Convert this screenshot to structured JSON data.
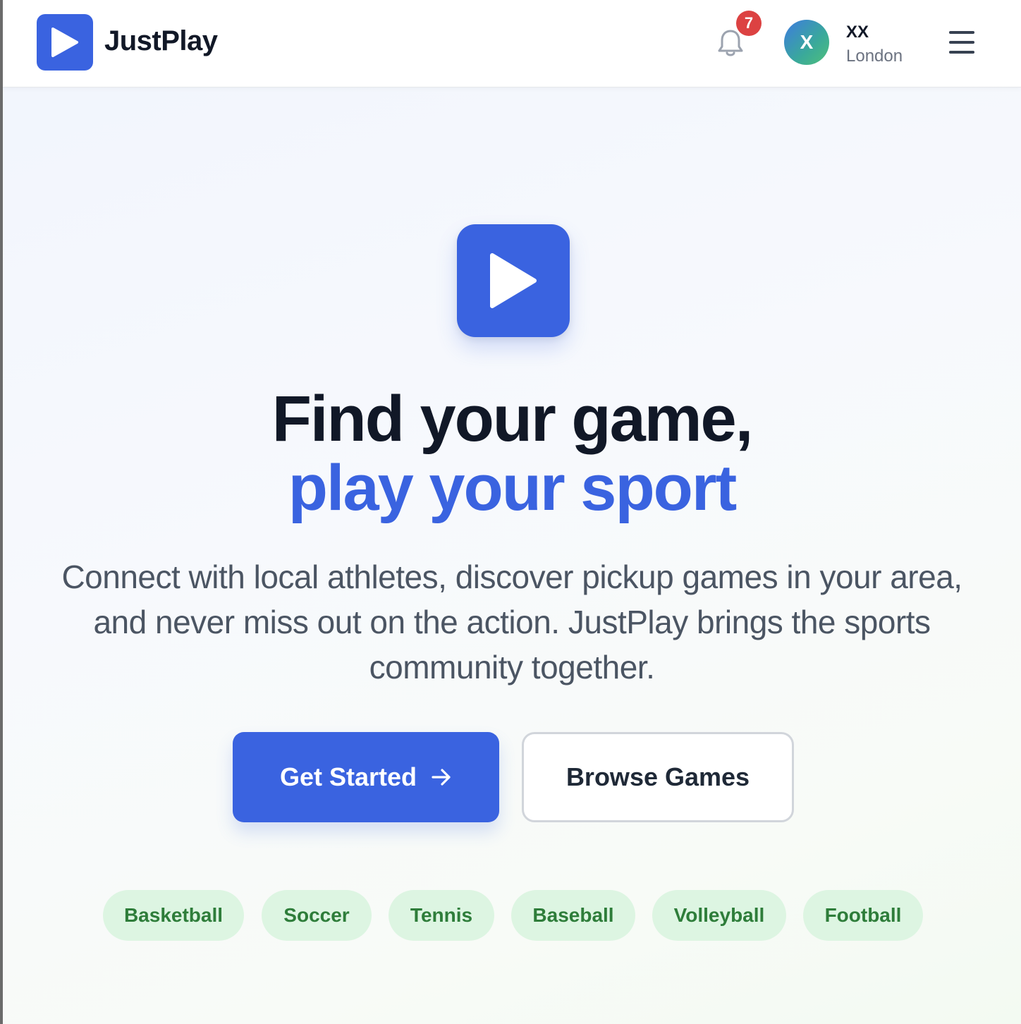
{
  "header": {
    "brand": "JustPlay",
    "notification_count": "7",
    "user": {
      "initial": "X",
      "name": "XX",
      "location": "London"
    }
  },
  "hero": {
    "headline_line1": "Find your game,",
    "headline_line2": "play your sport",
    "description": "Connect with local athletes, discover pickup games in your area, and never miss out on the action. JustPlay brings the sports community together.",
    "primary_button": "Get Started",
    "secondary_button": "Browse Games"
  },
  "sports": [
    "Basketball",
    "Soccer",
    "Tennis",
    "Baseball",
    "Volleyball",
    "Football"
  ],
  "icons": {
    "logo": "play-icon",
    "notifications": "bell-icon",
    "menu": "hamburger-menu-icon",
    "cta_arrow": "arrow-right-icon"
  },
  "colors": {
    "accent": "#3a63e0",
    "badge": "#dc4242",
    "chip_bg": "#ddf5e2",
    "chip_text": "#2e7d3a",
    "heading": "#111827",
    "body_text": "#4b5563"
  }
}
